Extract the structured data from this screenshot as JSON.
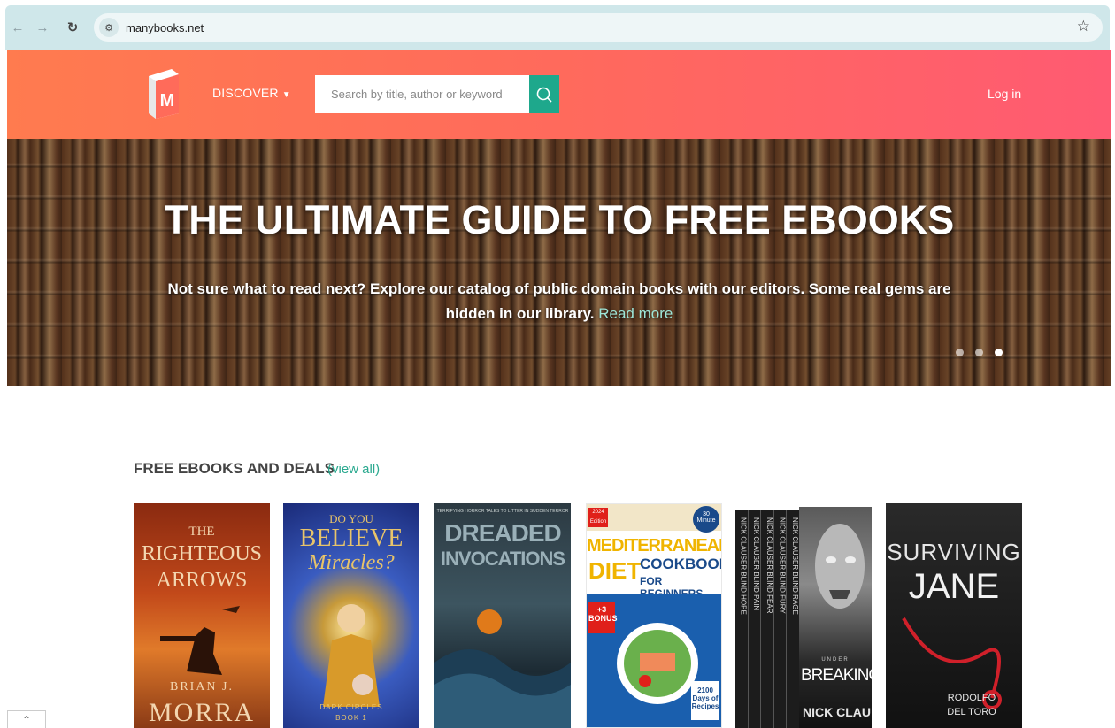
{
  "browser": {
    "url": "manybooks.net",
    "back_icon": "arrow-left-icon",
    "forward_icon": "arrow-right-icon",
    "reload_icon": "reload-icon",
    "star_icon": "star-icon"
  },
  "header": {
    "logo_letter": "M",
    "discover_label": "DISCOVER",
    "search_placeholder": "Search by title, author or keyword",
    "login_label": "Log in",
    "accent_color": "#1ea88c"
  },
  "hero": {
    "title": "THE ULTIMATE GUIDE TO FREE EBOOKS",
    "text": "Not sure what to read next? Explore our catalog of public domain books with our editors. Some real gems are hidden in our library.",
    "link": "Read more",
    "slide_count": 3,
    "active_slide": 3
  },
  "section": {
    "title": "FREE EBOOKS AND DEALS",
    "view_all": "(view all)"
  },
  "books": [
    {
      "title_line1": "THE",
      "title_line2": "RIGHTEOUS",
      "title_line3": "ARROWS",
      "author_line1": "BRIAN J.",
      "author_line2": "MORRA"
    },
    {
      "title_line1": "DO YOU",
      "title_line2": "BELIEVE",
      "title_line3": "Miracles?",
      "author_line1": "DARK CIRCLES",
      "author_line2": "BOOK 1"
    },
    {
      "title_line1": "DREADED",
      "title_line2": "INVOCATIONS",
      "tagline": "TERRIFYING HORROR TALES TO LITTER IN SUDDEN TERROR"
    },
    {
      "badge": "2024 Edition",
      "title_line1": "MEDITERRANEAN",
      "title_line2": "DIET",
      "title_line3": "COOKBOOK",
      "title_line4": "FOR BEGINNERS",
      "bonus": "+3 BONUS",
      "days": "2100 Days of Recipes",
      "minute": "30 Minute"
    },
    {
      "spine_author": "NICK CLAUSER",
      "spines": [
        "BLIND HOPE",
        "BLIND PAIN",
        "BLIND FEAR",
        "BLIND FURY",
        "BLIND RAGE"
      ],
      "front_title": "BREAKING",
      "front_top": "UNDER",
      "front_author": "NICK CLAU"
    },
    {
      "title_line1": "SURVIVING",
      "title_line2": "JANE",
      "author_line1": "RODOLFO",
      "author_line2": "DEL TORO"
    }
  ],
  "scroll_top_icon": "chevron-up-icon"
}
